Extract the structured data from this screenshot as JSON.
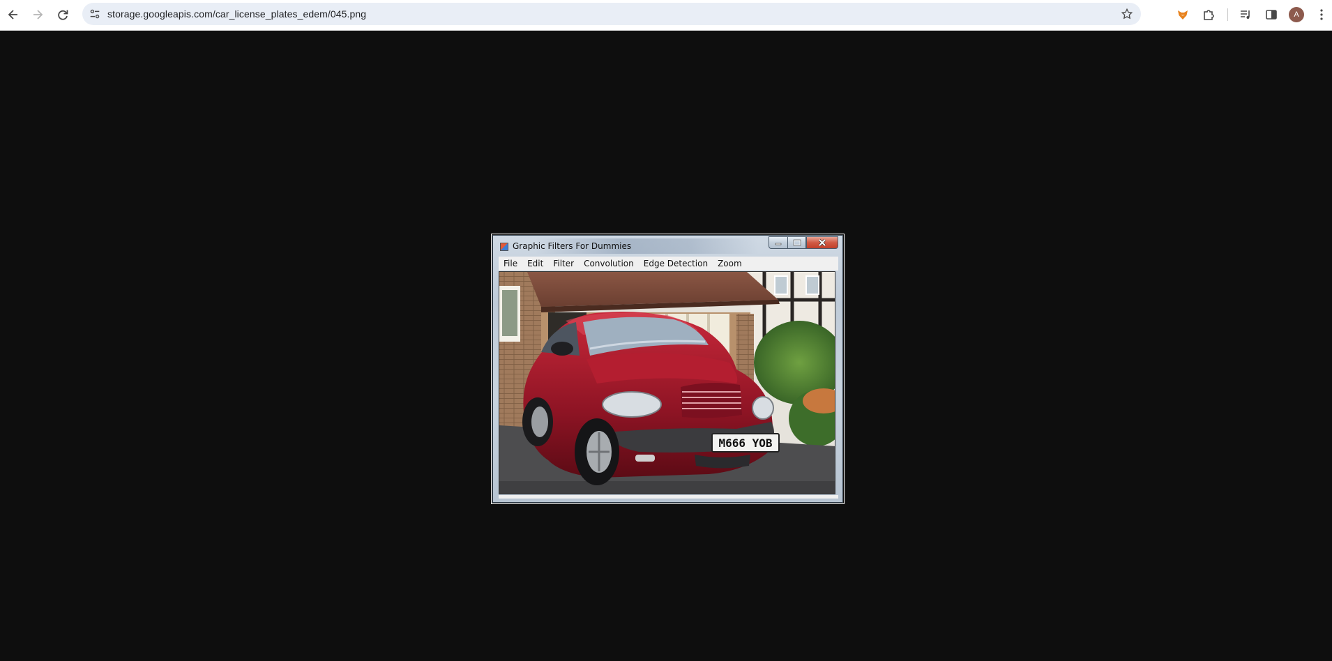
{
  "browser": {
    "url": "storage.googleapis.com/car_license_plates_edem/045.png",
    "profile_initial": "A",
    "icons": [
      "back-icon",
      "forward-icon",
      "reload-icon",
      "tune-icon",
      "star-icon",
      "fox-extension-icon",
      "puzzle-icon",
      "media-icon",
      "sidepanel-icon",
      "kebab-menu-icon"
    ]
  },
  "app_window": {
    "title": "Graphic Filters For Dummies",
    "menu": [
      "File",
      "Edit",
      "Filter",
      "Convolution",
      "Edge Detection",
      "Zoom"
    ]
  },
  "photo": {
    "plate_text": "M666 YOB"
  }
}
